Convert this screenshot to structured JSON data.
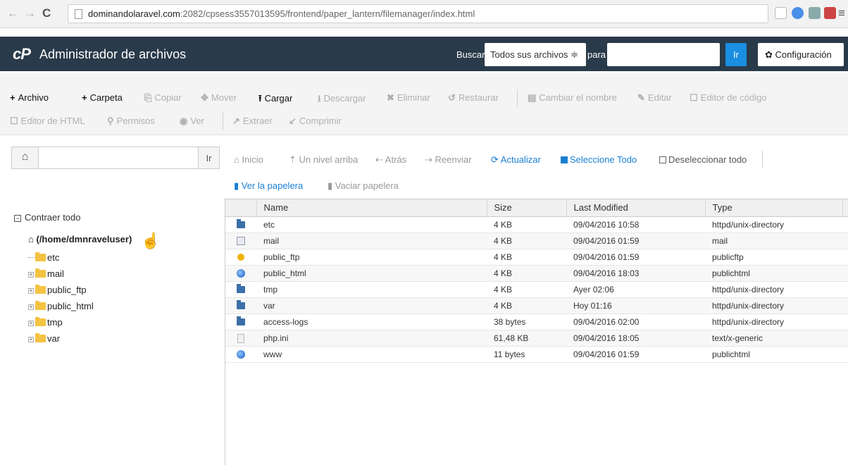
{
  "browser": {
    "url_domain": "dominandolaravel.com",
    "url_path": ":2082/cpsess3557013595/frontend/paper_lantern/filemanager/index.html"
  },
  "header": {
    "logo": "cP",
    "title": "Administrador de archivos",
    "search_label": "Buscar",
    "search_scope": "Todos sus archivos ≑",
    "para_label": "para",
    "go_label": "Ir",
    "config_label": "Configuración"
  },
  "toolbar": {
    "row1": [
      {
        "icon": "+",
        "label": "Archivo",
        "enabled": true
      },
      {
        "icon": "+",
        "label": "Carpeta",
        "enabled": true
      },
      {
        "icon": "⎘",
        "label": "Copiar",
        "enabled": false
      },
      {
        "icon": "✥",
        "label": "Mover",
        "enabled": false
      },
      {
        "icon": "⭱",
        "label": "Cargar",
        "enabled": true
      },
      {
        "icon": "⭳",
        "label": "Descargar",
        "enabled": false
      },
      {
        "icon": "✖",
        "label": "Eliminar",
        "enabled": false
      },
      {
        "icon": "↺",
        "label": "Restaurar",
        "enabled": false
      },
      {
        "icon": "▤",
        "label": "Cambiar el nombre",
        "enabled": false
      },
      {
        "icon": "✎",
        "label": "Editar",
        "enabled": false
      },
      {
        "icon": "☐",
        "label": "Editor de código",
        "enabled": false
      }
    ],
    "row2": [
      {
        "icon": "☐",
        "label": "Editor de HTML",
        "enabled": false
      },
      {
        "icon": "⚲",
        "label": "Permisos",
        "enabled": false
      },
      {
        "icon": "◉",
        "label": "Ver",
        "enabled": false
      },
      {
        "icon": "↗",
        "label": "Extraer",
        "enabled": false
      },
      {
        "icon": "↙",
        "label": "Comprimir",
        "enabled": false
      }
    ]
  },
  "left_panel": {
    "home_icon": "⌂",
    "go_label": "Ir",
    "collapse_label": "Contraer todo",
    "root_label": "(/home/dmnraveluser)",
    "tree": [
      "etc",
      "mail",
      "public_ftp",
      "public_html",
      "tmp",
      "var"
    ]
  },
  "nav": {
    "inicio": "⌂ Inicio",
    "arriba": "⇡ Un nivel arriba",
    "atras": "⇠ Atrás",
    "reenviar": "⇢ Reenviar",
    "actualizar": "⟳ Actualizar",
    "seleccionar": "Seleccione Todo",
    "deseleccionar": "Deseleccionar todo",
    "ver_papelera": "Ver la papelera",
    "vaciar_papelera": "Vaciar papelera"
  },
  "table": {
    "columns": [
      "Name",
      "Size",
      "Last Modified",
      "Type"
    ],
    "rows": [
      {
        "icon": "dir",
        "name": "etc",
        "size": "4 KB",
        "modified": "09/04/2016 10:58",
        "type": "httpd/unix-directory"
      },
      {
        "icon": "mail",
        "name": "mail",
        "size": "4 KB",
        "modified": "09/04/2016 01:59",
        "type": "mail"
      },
      {
        "icon": "ftp",
        "name": "public_ftp",
        "size": "4 KB",
        "modified": "09/04/2016 01:59",
        "type": "publicftp"
      },
      {
        "icon": "web",
        "name": "public_html",
        "size": "4 KB",
        "modified": "09/04/2016 18:03",
        "type": "publichtml"
      },
      {
        "icon": "dir",
        "name": "tmp",
        "size": "4 KB",
        "modified": "Ayer 02:06",
        "type": "httpd/unix-directory"
      },
      {
        "icon": "dir",
        "name": "var",
        "size": "4 KB",
        "modified": "Hoy 01:16",
        "type": "httpd/unix-directory"
      },
      {
        "icon": "dir",
        "name": "access-logs",
        "size": "38 bytes",
        "modified": "09/04/2016 02:00",
        "type": "httpd/unix-directory"
      },
      {
        "icon": "txt",
        "name": "php.ini",
        "size": "61,48 KB",
        "modified": "09/04/2016 18:05",
        "type": "text/x-generic"
      },
      {
        "icon": "web",
        "name": "www",
        "size": "11 bytes",
        "modified": "09/04/2016 01:59",
        "type": "publichtml"
      }
    ]
  }
}
